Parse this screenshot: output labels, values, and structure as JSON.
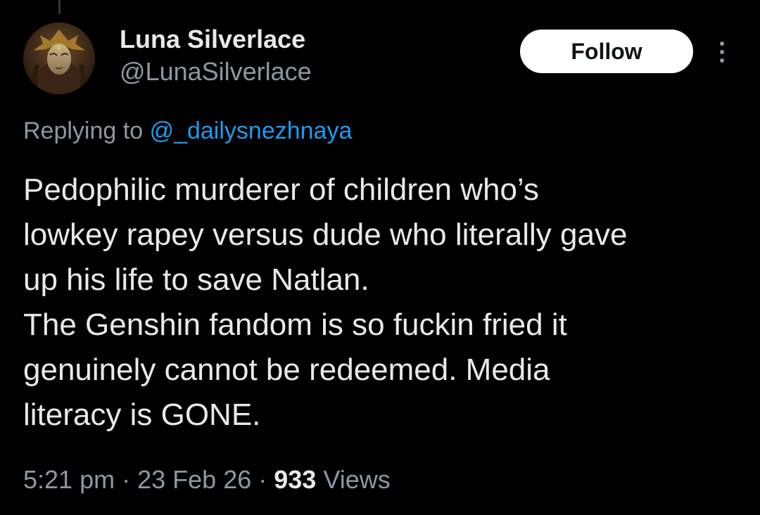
{
  "author": {
    "display_name": "Luna Silverlace",
    "handle": "@LunaSilverlace",
    "avatar_icon": "masked-character-avatar"
  },
  "actions": {
    "follow_label": "Follow",
    "more_icon": "more-vertical-icon"
  },
  "reply": {
    "prefix": "Replying to",
    "mention": "@_dailysnezhnaya"
  },
  "tweet": {
    "lines": [
      "Pedophilic murderer of children who’s",
      "lowkey rapey versus dude who literally gave",
      "up his life to save Natlan.",
      "The Genshin fandom is so fuckin fried it",
      "genuinely cannot be redeemed. Media",
      "literacy is GONE."
    ]
  },
  "meta": {
    "time": "5:21 pm",
    "separator": "·",
    "date": "23 Feb 26",
    "views_count": "933",
    "views_label": "Views"
  },
  "colors": {
    "background": "#000000",
    "text_primary": "#e7e9ea",
    "text_secondary": "#8b98a5",
    "link": "#1d9bf0",
    "button_bg": "#ffffff",
    "button_text": "#0f1419"
  }
}
